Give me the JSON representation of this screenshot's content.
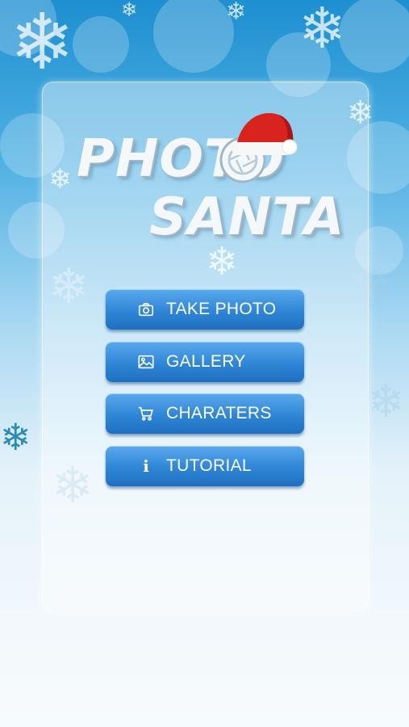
{
  "app": {
    "logo_line1": "PHOTO",
    "logo_line2": "SANTA"
  },
  "menu": {
    "take_photo": "TAKE PHOTO",
    "gallery": "GALLERY",
    "characters": "CHARATERS",
    "tutorial": "TUTORIAL"
  },
  "colors": {
    "button_top": "#5aa9ec",
    "button_bottom": "#1f6fc0",
    "hat_red": "#d8231f",
    "sky": "#1e8fd0"
  },
  "icons": {
    "take_photo": "camera-icon",
    "gallery": "image-icon",
    "characters": "cart-icon",
    "tutorial": "info-icon"
  }
}
